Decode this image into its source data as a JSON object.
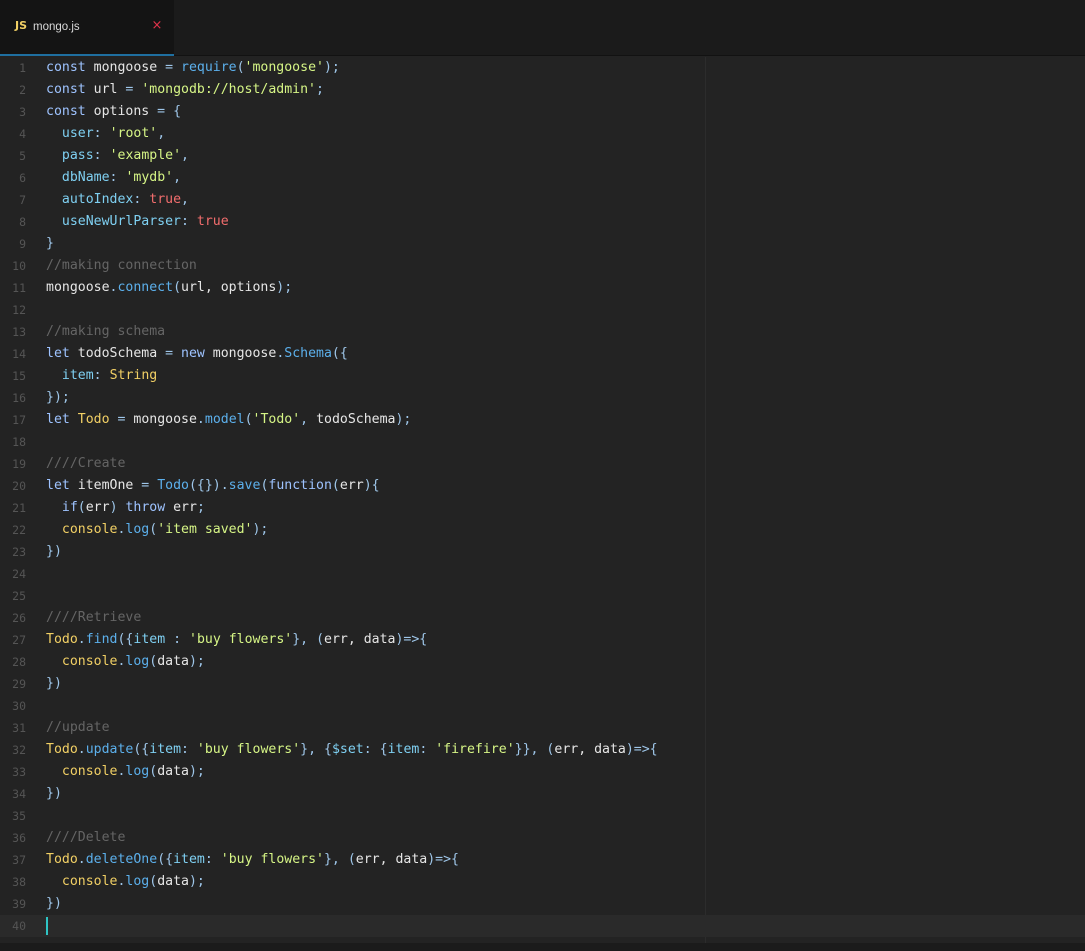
{
  "tab": {
    "icon_text": "JS",
    "filename": "mongo.js",
    "close_glyph": "×"
  },
  "colors": {
    "keyword": "#9ec3ff",
    "plain": "#e6e6e6",
    "string": "#d6f586",
    "property": "#7fd0f2",
    "method": "#5cb0ec",
    "boolean": "#f26d6d",
    "comment": "#656565",
    "class": "#f2d065",
    "punct": "#9fc7ea",
    "js_icon": "#f2d065",
    "close": "#e0324a",
    "caret": "#2ec4c4"
  },
  "editor": {
    "current_line": 40,
    "lines": [
      [
        [
          "keyword",
          "const"
        ],
        [
          "plain",
          " mongoose "
        ],
        [
          "punct",
          "="
        ],
        [
          "plain",
          " "
        ],
        [
          "method",
          "require"
        ],
        [
          "punct",
          "("
        ],
        [
          "string",
          "'mongoose'"
        ],
        [
          "punct",
          ");"
        ]
      ],
      [
        [
          "keyword",
          "const"
        ],
        [
          "plain",
          " url "
        ],
        [
          "punct",
          "="
        ],
        [
          "plain",
          " "
        ],
        [
          "string",
          "'mongodb://host/admin'"
        ],
        [
          "punct",
          ";"
        ]
      ],
      [
        [
          "keyword",
          "const"
        ],
        [
          "plain",
          " options "
        ],
        [
          "punct",
          "="
        ],
        [
          "plain",
          " "
        ],
        [
          "punct",
          "{"
        ]
      ],
      [
        [
          "plain",
          "  "
        ],
        [
          "property",
          "user"
        ],
        [
          "punct",
          ":"
        ],
        [
          "plain",
          " "
        ],
        [
          "string",
          "'root'"
        ],
        [
          "punct",
          ","
        ]
      ],
      [
        [
          "plain",
          "  "
        ],
        [
          "property",
          "pass"
        ],
        [
          "punct",
          ":"
        ],
        [
          "plain",
          " "
        ],
        [
          "string",
          "'example'"
        ],
        [
          "punct",
          ","
        ]
      ],
      [
        [
          "plain",
          "  "
        ],
        [
          "property",
          "dbName"
        ],
        [
          "punct",
          ":"
        ],
        [
          "plain",
          " "
        ],
        [
          "string",
          "'mydb'"
        ],
        [
          "punct",
          ","
        ]
      ],
      [
        [
          "plain",
          "  "
        ],
        [
          "property",
          "autoIndex"
        ],
        [
          "punct",
          ":"
        ],
        [
          "plain",
          " "
        ],
        [
          "boolean",
          "true"
        ],
        [
          "punct",
          ","
        ]
      ],
      [
        [
          "plain",
          "  "
        ],
        [
          "property",
          "useNewUrlParser"
        ],
        [
          "punct",
          ":"
        ],
        [
          "plain",
          " "
        ],
        [
          "boolean",
          "true"
        ]
      ],
      [
        [
          "punct",
          "}"
        ]
      ],
      [
        [
          "comment",
          "//making connection"
        ]
      ],
      [
        [
          "plain",
          "mongoose"
        ],
        [
          "punct",
          "."
        ],
        [
          "method",
          "connect"
        ],
        [
          "punct",
          "("
        ],
        [
          "plain",
          "url, options"
        ],
        [
          "punct",
          ");"
        ]
      ],
      [],
      [
        [
          "comment",
          "//making schema"
        ]
      ],
      [
        [
          "keyword",
          "let"
        ],
        [
          "plain",
          " todoSchema "
        ],
        [
          "punct",
          "="
        ],
        [
          "plain",
          " "
        ],
        [
          "keyword",
          "new"
        ],
        [
          "plain",
          " mongoose"
        ],
        [
          "punct",
          "."
        ],
        [
          "method",
          "Schema"
        ],
        [
          "punct",
          "({"
        ]
      ],
      [
        [
          "plain",
          "  "
        ],
        [
          "property",
          "item"
        ],
        [
          "punct",
          ":"
        ],
        [
          "plain",
          " "
        ],
        [
          "class",
          "String"
        ]
      ],
      [
        [
          "punct",
          "});"
        ]
      ],
      [
        [
          "keyword",
          "let"
        ],
        [
          "plain",
          " "
        ],
        [
          "class",
          "Todo"
        ],
        [
          "plain",
          " "
        ],
        [
          "punct",
          "="
        ],
        [
          "plain",
          " mongoose"
        ],
        [
          "punct",
          "."
        ],
        [
          "method",
          "model"
        ],
        [
          "punct",
          "("
        ],
        [
          "string",
          "'Todo'"
        ],
        [
          "punct",
          ","
        ],
        [
          "plain",
          " todoSchema"
        ],
        [
          "punct",
          ");"
        ]
      ],
      [],
      [
        [
          "comment",
          "////Create"
        ]
      ],
      [
        [
          "keyword",
          "let"
        ],
        [
          "plain",
          " itemOne "
        ],
        [
          "punct",
          "="
        ],
        [
          "plain",
          " "
        ],
        [
          "method",
          "Todo"
        ],
        [
          "punct",
          "({})."
        ],
        [
          "method",
          "save"
        ],
        [
          "punct",
          "("
        ],
        [
          "keyword",
          "function"
        ],
        [
          "punct",
          "("
        ],
        [
          "plain",
          "err"
        ],
        [
          "punct",
          "){"
        ]
      ],
      [
        [
          "plain",
          "  "
        ],
        [
          "keyword",
          "if"
        ],
        [
          "punct",
          "("
        ],
        [
          "plain",
          "err"
        ],
        [
          "punct",
          ")"
        ],
        [
          "plain",
          " "
        ],
        [
          "keyword",
          "throw"
        ],
        [
          "plain",
          " err"
        ],
        [
          "punct",
          ";"
        ]
      ],
      [
        [
          "plain",
          "  "
        ],
        [
          "class",
          "console"
        ],
        [
          "punct",
          "."
        ],
        [
          "method",
          "log"
        ],
        [
          "punct",
          "("
        ],
        [
          "string",
          "'item saved'"
        ],
        [
          "punct",
          ");"
        ]
      ],
      [
        [
          "punct",
          "})"
        ]
      ],
      [],
      [],
      [
        [
          "comment",
          "////Retrieve"
        ]
      ],
      [
        [
          "class",
          "Todo"
        ],
        [
          "punct",
          "."
        ],
        [
          "method",
          "find"
        ],
        [
          "punct",
          "({"
        ],
        [
          "property",
          "item"
        ],
        [
          "plain",
          " "
        ],
        [
          "punct",
          ":"
        ],
        [
          "plain",
          " "
        ],
        [
          "string",
          "'buy flowers'"
        ],
        [
          "punct",
          "},"
        ],
        [
          "plain",
          " "
        ],
        [
          "punct",
          "("
        ],
        [
          "plain",
          "err, data"
        ],
        [
          "punct",
          ")=>{"
        ]
      ],
      [
        [
          "plain",
          "  "
        ],
        [
          "class",
          "console"
        ],
        [
          "punct",
          "."
        ],
        [
          "method",
          "log"
        ],
        [
          "punct",
          "("
        ],
        [
          "plain",
          "data"
        ],
        [
          "punct",
          ");"
        ]
      ],
      [
        [
          "punct",
          "})"
        ]
      ],
      [],
      [
        [
          "comment",
          "//update"
        ]
      ],
      [
        [
          "class",
          "Todo"
        ],
        [
          "punct",
          "."
        ],
        [
          "method",
          "update"
        ],
        [
          "punct",
          "({"
        ],
        [
          "property",
          "item"
        ],
        [
          "punct",
          ":"
        ],
        [
          "plain",
          " "
        ],
        [
          "string",
          "'buy flowers'"
        ],
        [
          "punct",
          "},"
        ],
        [
          "plain",
          " "
        ],
        [
          "punct",
          "{"
        ],
        [
          "property",
          "$set"
        ],
        [
          "punct",
          ":"
        ],
        [
          "plain",
          " "
        ],
        [
          "punct",
          "{"
        ],
        [
          "property",
          "item"
        ],
        [
          "punct",
          ":"
        ],
        [
          "plain",
          " "
        ],
        [
          "string",
          "'firefire'"
        ],
        [
          "punct",
          "}},"
        ],
        [
          "plain",
          " "
        ],
        [
          "punct",
          "("
        ],
        [
          "plain",
          "err, data"
        ],
        [
          "punct",
          ")=>{"
        ]
      ],
      [
        [
          "plain",
          "  "
        ],
        [
          "class",
          "console"
        ],
        [
          "punct",
          "."
        ],
        [
          "method",
          "log"
        ],
        [
          "punct",
          "("
        ],
        [
          "plain",
          "data"
        ],
        [
          "punct",
          ");"
        ]
      ],
      [
        [
          "punct",
          "})"
        ]
      ],
      [],
      [
        [
          "comment",
          "////Delete"
        ]
      ],
      [
        [
          "class",
          "Todo"
        ],
        [
          "punct",
          "."
        ],
        [
          "method",
          "deleteOne"
        ],
        [
          "punct",
          "({"
        ],
        [
          "property",
          "item"
        ],
        [
          "punct",
          ":"
        ],
        [
          "plain",
          " "
        ],
        [
          "string",
          "'buy flowers'"
        ],
        [
          "punct",
          "},"
        ],
        [
          "plain",
          " "
        ],
        [
          "punct",
          "("
        ],
        [
          "plain",
          "err, data"
        ],
        [
          "punct",
          ")=>{"
        ]
      ],
      [
        [
          "plain",
          "  "
        ],
        [
          "class",
          "console"
        ],
        [
          "punct",
          "."
        ],
        [
          "method",
          "log"
        ],
        [
          "punct",
          "("
        ],
        [
          "plain",
          "data"
        ],
        [
          "punct",
          ");"
        ]
      ],
      [
        [
          "punct",
          "})"
        ]
      ],
      []
    ]
  }
}
